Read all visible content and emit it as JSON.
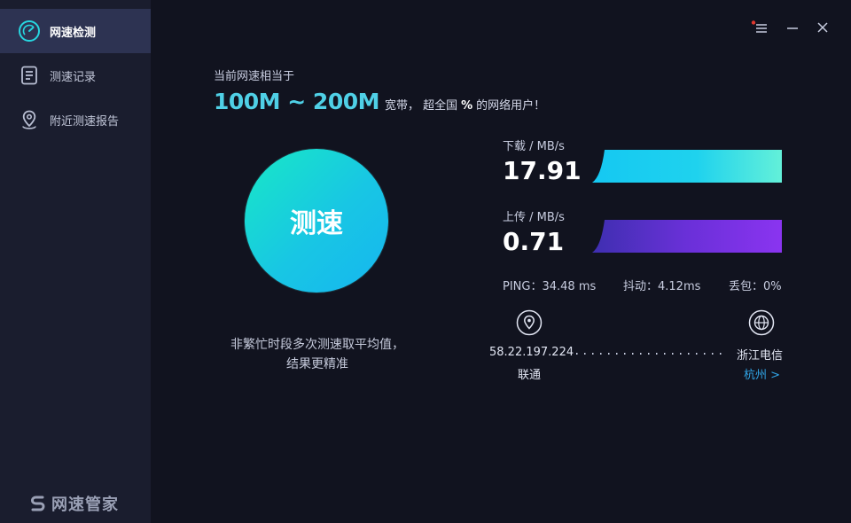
{
  "sidebar": {
    "items": [
      {
        "label": "网速检测",
        "icon": "speedometer-icon",
        "active": true
      },
      {
        "label": "测速记录",
        "icon": "document-icon",
        "active": false
      },
      {
        "label": "附近测速报告",
        "icon": "location-pin-icon",
        "active": false
      }
    ],
    "brand": "网速管家"
  },
  "window": {
    "menu_icon": "menu-icon",
    "minimize_icon": "minimize-icon",
    "close_icon": "close-icon",
    "notification_dot_color": "#e0382e"
  },
  "headline": {
    "subtitle": "当前网速相当于",
    "range": "100M ~ 200M",
    "text_before": "宽带，  超全国",
    "percent": "%",
    "text_after": "的网络用户！"
  },
  "test": {
    "button_label": "测速",
    "tip": "非繁忙时段多次测速取平均值，结果更精准"
  },
  "download": {
    "label": "下载 / MB/s",
    "value": "17.91",
    "colors": [
      "#15c8f2",
      "#63f0d9"
    ]
  },
  "upload": {
    "label": "上传 / MB/s",
    "value": "0.71",
    "colors": [
      "#3e2fb0",
      "#8a34f0"
    ]
  },
  "stats": {
    "ping": "PING：34.48 ms",
    "jitter": "抖动：4.12ms",
    "loss": "丢包：0%"
  },
  "route": {
    "client_ip": "58.22.197.224",
    "client_isp": "联通",
    "server_name": "浙江电信",
    "server_city": "杭州 >"
  },
  "colors": {
    "accent": "#4fd0e6",
    "link": "#31a6e8",
    "sidebar_bg": "#1a1d2e",
    "main_bg": "#11131f"
  }
}
